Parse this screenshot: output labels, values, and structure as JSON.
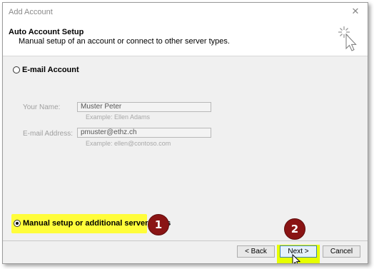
{
  "window": {
    "title": "Add Account",
    "close_glyph": "✕"
  },
  "header": {
    "title": "Auto Account Setup",
    "subtitle": "Manual setup of an account or connect to other server types.",
    "icon": "magic-wand-cursor-icon"
  },
  "email_option": {
    "label": "E-mail Account",
    "selected": false
  },
  "fields": {
    "name": {
      "label": "Your Name:",
      "value": "Muster  Peter",
      "example": "Example: Ellen Adams"
    },
    "email": {
      "label": "E-mail Address:",
      "value": "pmuster@ethz.ch",
      "example": "Example: ellen@contoso.com"
    }
  },
  "manual_option": {
    "label": "Manual setup or additional server types",
    "selected": true
  },
  "annotations": {
    "badge_1": "1",
    "badge_2": "2",
    "highlight_color": "#fffd3a",
    "badge_color": "#8a1414"
  },
  "buttons": {
    "back": "< Back",
    "next": "Next >",
    "cancel": "Cancel"
  }
}
